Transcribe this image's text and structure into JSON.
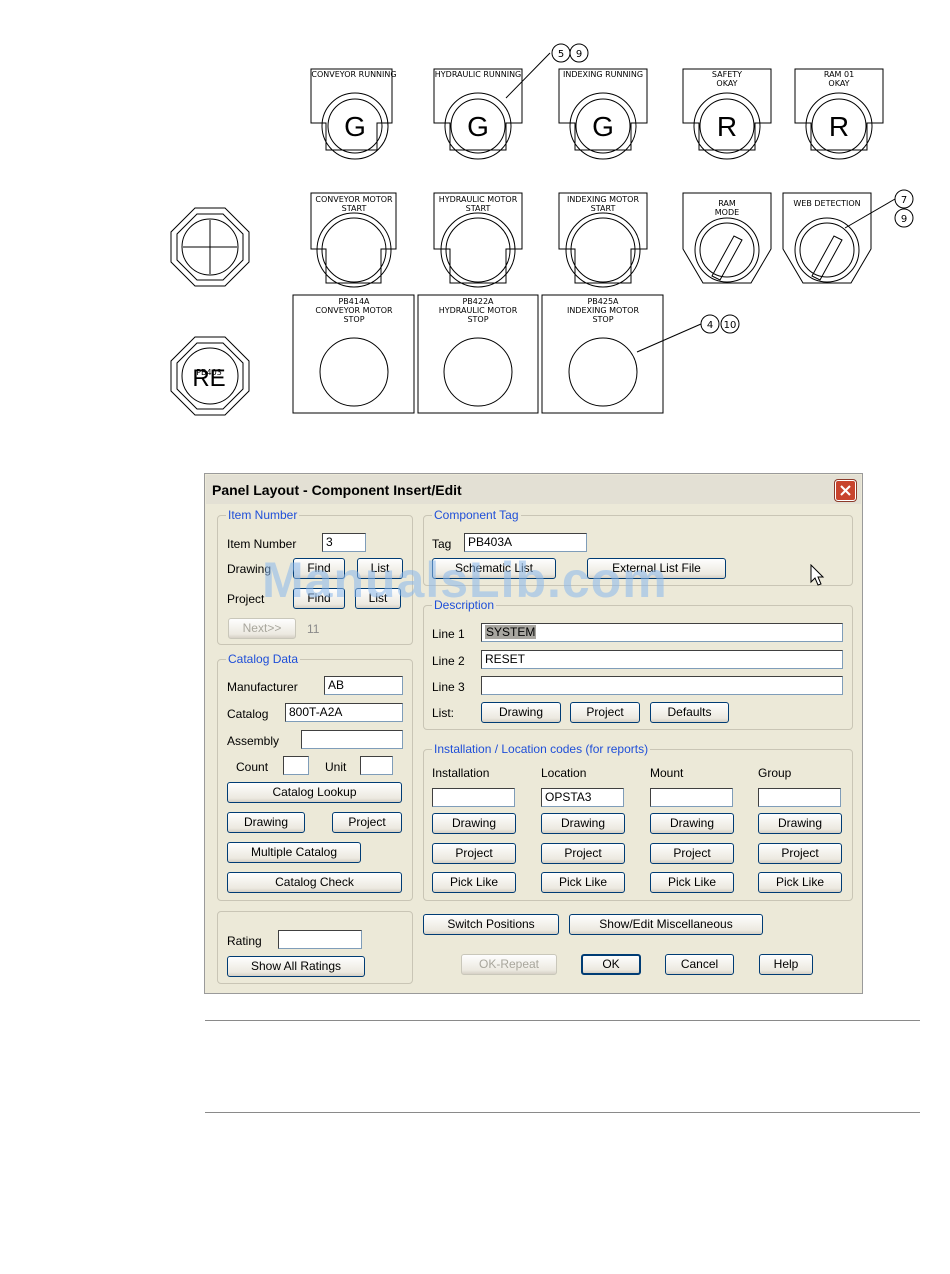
{
  "drawing": {
    "row1": [
      {
        "label1": "CONVEYOR  RUNNING",
        "label2": "",
        "letter": "G"
      },
      {
        "label1": "HYDRAULIC  RUNNING",
        "label2": "",
        "letter": "G"
      },
      {
        "label1": "INDEXING  RUNNING",
        "label2": "",
        "letter": "G"
      },
      {
        "label1": "SAFETY",
        "label2": "OKAY",
        "letter": "R"
      },
      {
        "label1": "RAM  01",
        "label2": "OKAY",
        "letter": "R"
      }
    ],
    "row2": [
      {
        "label1": "CONVEYOR  MOTOR",
        "label2": "START"
      },
      {
        "label1": "HYDRAULIC  MOTOR",
        "label2": "START"
      },
      {
        "label1": "INDEXING  MOTOR",
        "label2": "START"
      }
    ],
    "selectors": [
      {
        "label1": "RAM",
        "label2": "MODE"
      },
      {
        "label1": "WEB  DETECTION",
        "label2": ""
      }
    ],
    "row3": [
      {
        "label1": "PB414A",
        "label2": "CONVEYOR  MOTOR",
        "label3": "STOP"
      },
      {
        "label1": "PB422A",
        "label2": "HYDRAULIC  MOTOR",
        "label3": "STOP"
      },
      {
        "label1": "PB425A",
        "label2": "INDEXING  MOTOR",
        "label3": "STOP"
      }
    ],
    "reset_letters": "RE",
    "reset_tag": "PB403",
    "callouts": {
      "top": [
        "5",
        "9"
      ],
      "right_a": "7",
      "right_b": "9",
      "bottom": [
        "4",
        "10"
      ]
    }
  },
  "dialog": {
    "title": "Panel Layout - Component Insert/Edit",
    "item_number": {
      "legend": "Item Number",
      "item_label": "Item Number",
      "item_value": "3",
      "drawing_label": "Drawing",
      "project_label": "Project",
      "find": "Find",
      "list": "List",
      "project_find": "Find",
      "project_list": "List",
      "next": "Next>>",
      "next_value": "11"
    },
    "catalog": {
      "legend": "Catalog Data",
      "manufacturer_label": "Manufacturer",
      "manufacturer": "AB",
      "catalog_label": "Catalog",
      "catalog": "800T-A2A",
      "assembly_label": "Assembly",
      "assembly": "",
      "count_label": "Count",
      "count": "",
      "unit_label": "Unit",
      "unit": "",
      "lookup": "Catalog Lookup",
      "drawing": "Drawing",
      "project": "Project",
      "multiple": "Multiple Catalog",
      "check": "Catalog Check"
    },
    "rating": {
      "label": "Rating",
      "value": "",
      "show_all": "Show All Ratings"
    },
    "component_tag": {
      "legend": "Component Tag",
      "tag_label": "Tag",
      "tag": "PB403A",
      "schematic_list": "Schematic List",
      "external_list": "External List File"
    },
    "description": {
      "legend": "Description",
      "line1_label": "Line 1",
      "line1": "SYSTEM",
      "line2_label": "Line 2",
      "line2": "RESET",
      "line3_label": "Line 3",
      "line3": "",
      "list_label": "List:",
      "drawing": "Drawing",
      "project": "Project",
      "defaults": "Defaults"
    },
    "install": {
      "legend": "Installation / Location codes  (for reports)",
      "columns": [
        {
          "label": "Installation",
          "value": "",
          "drawing": "Drawing",
          "project": "Project",
          "pick": "Pick Like"
        },
        {
          "label": "Location",
          "value": "OPSTA3",
          "drawing": "Drawing",
          "project": "Project",
          "pick": "Pick Like"
        },
        {
          "label": "Mount",
          "value": "",
          "drawing": "Drawing",
          "project": "Project",
          "pick": "Pick Like"
        },
        {
          "label": "Group",
          "value": "",
          "drawing": "Drawing",
          "project": "Project",
          "pick": "Pick Like"
        }
      ]
    },
    "bottom": {
      "switch_positions": "Switch Positions",
      "show_edit_misc": "Show/Edit Miscellaneous",
      "ok_repeat": "OK-Repeat",
      "ok": "OK",
      "cancel": "Cancel",
      "help": "Help"
    }
  },
  "watermark": "ManualsLib.com"
}
